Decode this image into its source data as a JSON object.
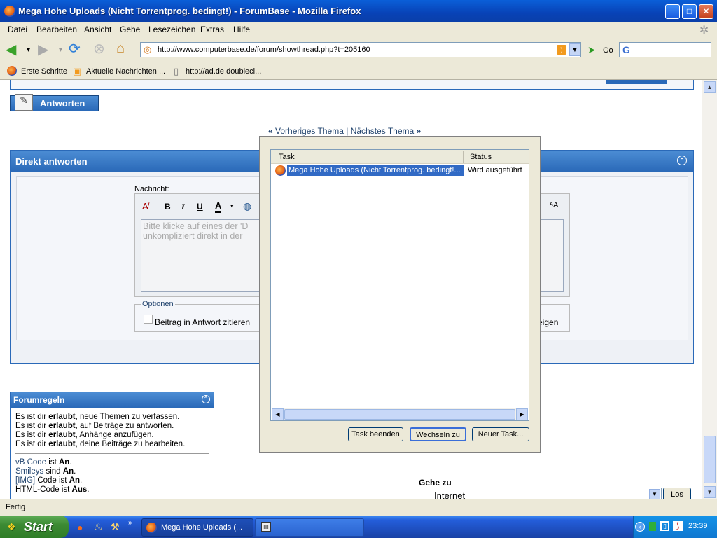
{
  "window": {
    "title": "Mega Hohe Uploads (Nicht Torrentprog. bedingt!) - ForumBase - Mozilla Firefox"
  },
  "menu": [
    "Datei",
    "Bearbeiten",
    "Ansicht",
    "Gehe",
    "Lesezeichen",
    "Extras",
    "Hilfe"
  ],
  "nav": {
    "url": "http://www.computerbase.de/forum/showthread.php?t=205160",
    "go_label": "Go",
    "search_placeholder": ""
  },
  "bookmarks": [
    "Erste Schritte",
    "Aktuelle Nachrichten ...",
    "http://ad.de.doublecl..."
  ],
  "page": {
    "reply_button": "Antworten",
    "prev_thread": "Vorheriges Thema",
    "separator": "|",
    "next_thread": "Nächstes Thema",
    "quick_reply_title": "Direkt antworten",
    "message_label": "Nachricht:",
    "editor_placeholder_line1": "Bitte klicke auf eines der 'D",
    "editor_placeholder_line2": "unkompliziert direkt in der",
    "options_legend": "Optionen",
    "quote_checkbox": "Beitrag in Antwort zitieren",
    "right_partial": "eigen",
    "rules_title": "Forumregeln",
    "rules": [
      {
        "pre": "Es ist dir ",
        "bold": "erlaubt",
        "post": ", neue Themen zu verfassen."
      },
      {
        "pre": "Es ist dir ",
        "bold": "erlaubt",
        "post": ", auf Beiträge zu antworten."
      },
      {
        "pre": "Es ist dir ",
        "bold": "erlaubt",
        "post": ", Anhänge anzufügen."
      },
      {
        "pre": "Es ist dir ",
        "bold": "erlaubt",
        "post": ", deine Beiträge zu bearbeiten."
      }
    ],
    "codes": [
      {
        "link": "vB Code",
        "mid": " ist ",
        "val": "An"
      },
      {
        "link": "Smileys",
        "mid": " sind ",
        "val": "An"
      },
      {
        "link": "[IMG]",
        "mid": " Code ist ",
        "val": "An"
      },
      {
        "link": "",
        "mid": "HTML-Code ist ",
        "val": "Aus"
      }
    ],
    "goto_label": "Gehe zu",
    "goto_value": "Internet",
    "goto_button": "Los"
  },
  "dialog": {
    "col_task": "Task",
    "col_status": "Status",
    "row_task": "Mega Hohe Uploads (Nicht Torrentprog. bedingt!...",
    "row_status": "Wird ausgeführt",
    "btn_end": "Task beenden",
    "btn_switch": "Wechseln zu",
    "btn_new": "Neuer Task..."
  },
  "status": {
    "text": "Fertig"
  },
  "taskbar": {
    "start": "Start",
    "task1": "Mega Hohe Uploads (...",
    "clock": "23:39"
  }
}
